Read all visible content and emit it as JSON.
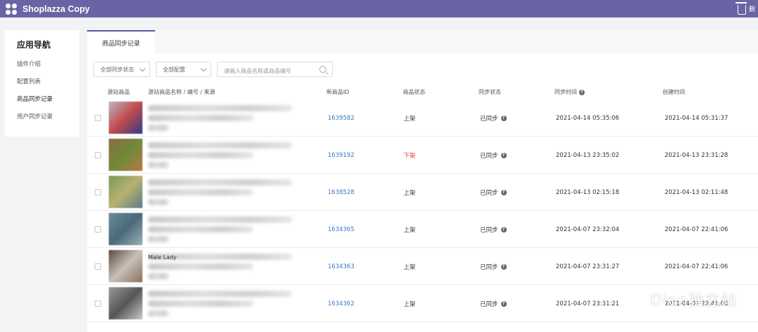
{
  "app": {
    "title": "Shoplazza Copy",
    "top_right_text": "删"
  },
  "sidebar": {
    "title": "应用导航",
    "items": [
      {
        "label": "插件介绍"
      },
      {
        "label": "配置列表"
      },
      {
        "label": "商品同步记录"
      },
      {
        "label": "用户同步记录"
      }
    ]
  },
  "tabs": [
    {
      "label": "商品同步记录"
    }
  ],
  "filters": {
    "sync_status": "全部同步状态",
    "config": "全部配置",
    "search_placeholder": "请输入商品名称或商品编号"
  },
  "table": {
    "columns": {
      "source_product": "源站商品",
      "source_name": "源站商品名称 / 编号 / 来源",
      "new_id": "新商品ID",
      "product_status": "商品状态",
      "sync_status": "同步状态",
      "sync_time": "同步时间",
      "created_time": "创建时间"
    },
    "rows": [
      {
        "name": "",
        "new_id": "1639582",
        "status": "上架",
        "status_kind": "on",
        "sync": "已同步",
        "sync_time": "2021-04-14 05:35:06",
        "created": "2021-04-14 05:31:37"
      },
      {
        "name": "",
        "new_id": "1639192",
        "status": "下架",
        "status_kind": "off",
        "sync": "已同步",
        "sync_time": "2021-04-13 23:35:02",
        "created": "2021-04-13 23:31:28"
      },
      {
        "name": "",
        "new_id": "1638528",
        "status": "上架",
        "status_kind": "on",
        "sync": "已同步",
        "sync_time": "2021-04-13 02:15:18",
        "created": "2021-04-13 02:11:48"
      },
      {
        "name": "",
        "new_id": "1634365",
        "status": "上架",
        "status_kind": "on",
        "sync": "已同步",
        "sync_time": "2021-04-07 23:32:04",
        "created": "2021-04-07 22:41:06"
      },
      {
        "name": "Male Lady",
        "new_id": "1634363",
        "status": "上架",
        "status_kind": "on",
        "sync": "已同步",
        "sync_time": "2021-04-07 23:31:27",
        "created": "2021-04-07 22:41:06"
      },
      {
        "name": "",
        "new_id": "1634362",
        "status": "上架",
        "status_kind": "on",
        "sync": "已同步",
        "sync_time": "2021-04-07 23:31:21",
        "created": "2021-04-07 22:41:06"
      }
    ]
  },
  "watermark": {
    "text": "Dion独立站"
  },
  "colors": {
    "topbar": "#6a64a4",
    "accent": "#5c56a0",
    "link": "#3a78c8",
    "off": "#e03a3a"
  }
}
